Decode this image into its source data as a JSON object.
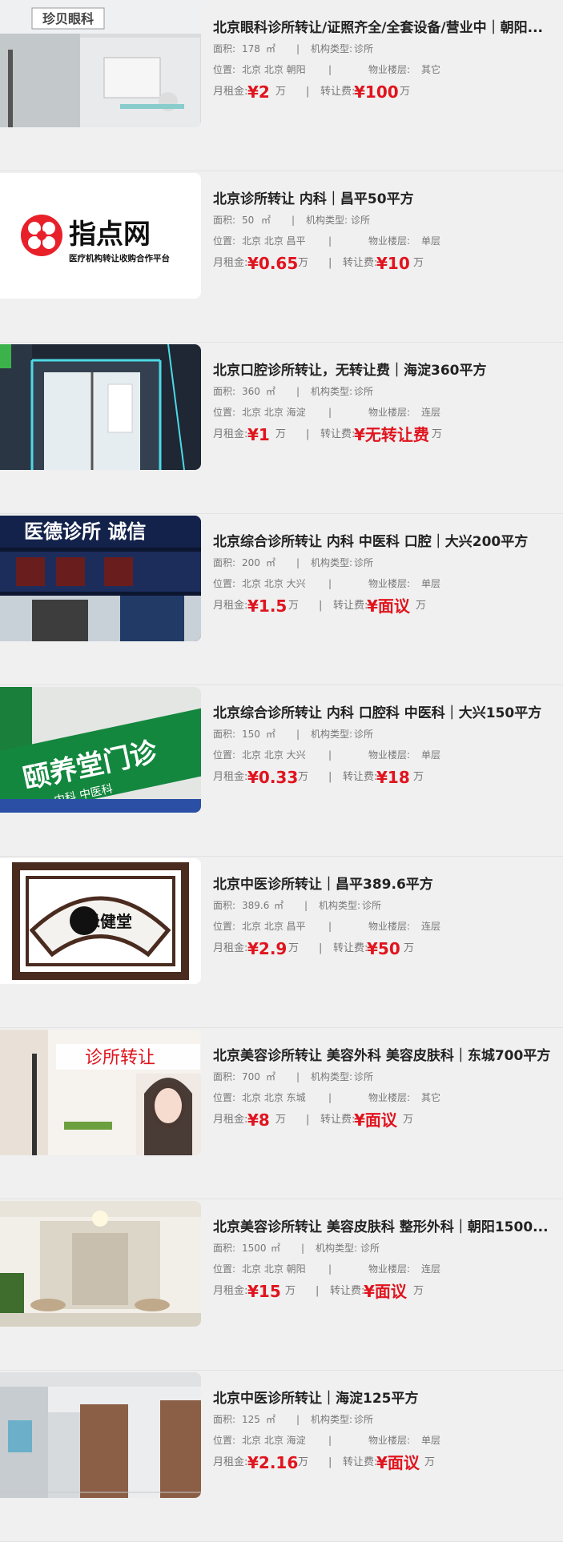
{
  "labels": {
    "area": "面积:",
    "sqm": "㎡",
    "sep": "|",
    "org_type": "机构类型:",
    "location": "位置:",
    "floor": "物业楼层:",
    "rent": "月租金:",
    "transfer": "转让费:",
    "wan": "万"
  },
  "colors": {
    "price": "#e0141e",
    "background": "#f0f0f0",
    "meta": "#777777"
  },
  "listings": [
    {
      "title": "北京眼科诊所转让/证照齐全/全套设备/营业中｜朝阳...",
      "area": "178",
      "org_type": "诊所",
      "location": "北京 北京 朝阳",
      "floor": "其它",
      "rent": "¥2",
      "transfer": "¥100",
      "thumb_text": "珍贝眼科",
      "thumb_icon": "clinic-storefront-photo"
    },
    {
      "title": "北京诊所转让 内科｜昌平50平方",
      "area": "50",
      "org_type": "诊所",
      "location": "北京 北京 昌平",
      "floor": "单层",
      "rent": "¥0.65",
      "transfer": "¥10",
      "thumb_text": "指点网",
      "thumb_sub": "医疗机构转让收购合作平台",
      "thumb_icon": "zhidianwang-logo"
    },
    {
      "title": "北京口腔诊所转让，无转让费｜海淀360平方",
      "area": "360",
      "org_type": "诊所",
      "location": "北京 北京 海淀",
      "floor": "连层",
      "rent": "¥1",
      "transfer": "¥无转让费",
      "thumb_icon": "glass-door-photo"
    },
    {
      "title": "北京综合诊所转让 内科 中医科 口腔｜大兴200平方",
      "area": "200",
      "org_type": "诊所",
      "location": "北京 北京 大兴",
      "floor": "单层",
      "rent": "¥1.5",
      "transfer": "¥面议",
      "thumb_text": "医德诊所 诚信",
      "thumb_icon": "night-sign-photo"
    },
    {
      "title": "北京综合诊所转让 内科 口腔科 中医科｜大兴150平方",
      "area": "150",
      "org_type": "诊所",
      "location": "北京 北京 大兴",
      "floor": "单层",
      "rent": "¥0.33",
      "transfer": "¥18",
      "thumb_text": "颐养堂门诊",
      "thumb_sub": "内科  中医科",
      "thumb_icon": "green-sign-photo"
    },
    {
      "title": "北京中医诊所转让｜昌平389.6平方",
      "area": "389.6",
      "org_type": "诊所",
      "location": "北京 北京 昌平",
      "floor": "连层",
      "rent": "¥2.9",
      "transfer": "¥50",
      "thumb_text": "禾健堂",
      "thumb_icon": "fan-lattice-photo"
    },
    {
      "title": "北京美容诊所转让 美容外科 美容皮肤科｜东城700平方",
      "area": "700",
      "org_type": "诊所",
      "location": "北京 北京 东城",
      "floor": "其它",
      "rent": "¥8",
      "transfer": "¥面议",
      "thumb_text": "诊所转让",
      "thumb_icon": "beauty-clinic-photo"
    },
    {
      "title": "北京美容诊所转让 美容皮肤科 整形外科｜朝阳1500...",
      "area": "1500",
      "org_type": "诊所",
      "location": "北京 北京 朝阳",
      "floor": "连层",
      "rent": "¥15",
      "transfer": "¥面议",
      "thumb_icon": "lobby-photo"
    },
    {
      "title": "北京中医诊所转让｜海淀125平方",
      "area": "125",
      "org_type": "诊所",
      "location": "北京 北京 海淀",
      "floor": "单层",
      "rent": "¥2.16",
      "transfer": "¥面议",
      "thumb_icon": "corridor-photo"
    }
  ]
}
